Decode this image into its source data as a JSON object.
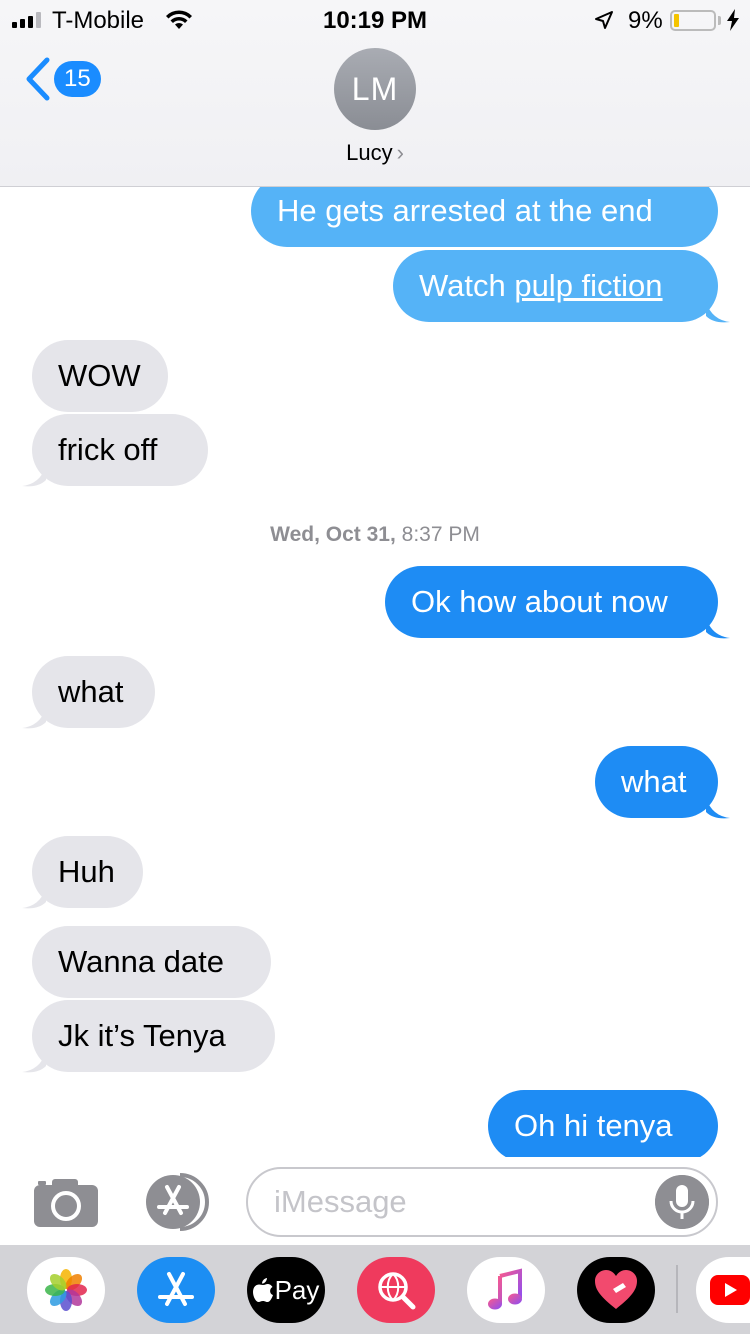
{
  "status_bar": {
    "carrier": "T-Mobile",
    "time": "10:19 PM",
    "battery_percent": "9%",
    "battery_level": 0.09,
    "icons": [
      "signal-icon",
      "wifi-icon",
      "location-icon",
      "battery-icon",
      "charging-icon"
    ]
  },
  "header": {
    "back_count": "15",
    "avatar_initials": "LM",
    "contact_name": "Lucy",
    "chevron": "›"
  },
  "messages": [
    {
      "direction": "outgoing",
      "text": "He gets arrested at the end"
    },
    {
      "direction": "outgoing",
      "text_prefix": "Watch ",
      "link_text": "pulp fiction"
    },
    {
      "direction": "incoming",
      "text": "WOW"
    },
    {
      "direction": "incoming",
      "text": "frick off"
    },
    {
      "type": "timestamp",
      "day": "Wed, Oct 31,",
      "time": "8:37 PM"
    },
    {
      "direction": "outgoing",
      "text": "Ok how about now"
    },
    {
      "direction": "incoming",
      "text": "what"
    },
    {
      "direction": "outgoing",
      "text": "what"
    },
    {
      "direction": "incoming",
      "text": "Huh"
    },
    {
      "direction": "incoming",
      "text": "Wanna date"
    },
    {
      "direction": "incoming",
      "text": "Jk it’s Tenya"
    },
    {
      "direction": "outgoing",
      "text": "Oh hi tenya"
    }
  ],
  "compose": {
    "placeholder": "iMessage",
    "icons": [
      "camera-icon",
      "app-store-icon",
      "microphone-icon"
    ]
  },
  "app_drawer": {
    "apple_pay_label": "Pay",
    "apps": [
      "photos",
      "app-store",
      "apple-pay",
      "search-images",
      "music",
      "heart-stickers",
      "youtube"
    ]
  },
  "colors": {
    "incoming": "#e5e5ea",
    "outgoing": "#1e8cf4",
    "outgoing_faded": "#55b3f7",
    "badge": "#1a8cff",
    "timestamp": "#8e8e93"
  }
}
